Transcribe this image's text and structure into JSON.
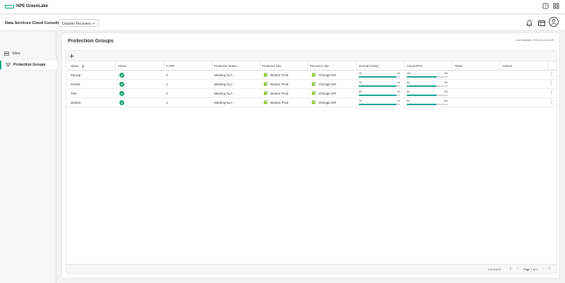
{
  "topbar": {
    "brand": "HPE GreenLake"
  },
  "console": {
    "title": "Data Services Cloud Console",
    "separator": "|",
    "service_selected": "Disaster Recovery"
  },
  "sidebar": {
    "items": [
      {
        "label": "Sites",
        "icon": "server-icon",
        "active": false
      },
      {
        "label": "Protection Groups",
        "icon": "protection-group-icon",
        "active": true
      }
    ]
  },
  "main": {
    "title": "Protection Groups",
    "last_updated": "Last Updated: 2023-04-13 11:25",
    "columns": [
      "Name",
      "Status",
      "# VMs",
      "Protection Status",
      "Protected Site",
      "Recovery Site",
      "Journal History",
      "Actual RPO",
      "Tasks",
      "Actions"
    ],
    "rows": [
      {
        "name": "MyApp",
        "status": "ok",
        "vms": "3",
        "protection_status": "Meeting SLA",
        "protected_site": "Boston Prod",
        "recovery_site": "Chicago DR",
        "journal_min": "7d",
        "journal_max": "1d",
        "journal_fill": 0.92,
        "rpo_min": "10s",
        "rpo_max": "5m",
        "rpo_fill": 0.72
      },
      {
        "name": "Oracle",
        "status": "ok",
        "vms": "1",
        "protection_status": "Meeting SLA",
        "protected_site": "Boston Prod",
        "recovery_site": "Chicago DR",
        "journal_min": "7d",
        "journal_max": "1d",
        "journal_fill": 0.92,
        "rpo_min": "5s",
        "rpo_max": "5m",
        "rpo_fill": 0.72
      },
      {
        "name": "Test",
        "status": "ok",
        "vms": "2",
        "protection_status": "Meeting SLA",
        "protected_site": "Boston Prod",
        "recovery_site": "Chicago DR",
        "journal_min": "6d",
        "journal_max": "1d",
        "journal_fill": 0.92,
        "rpo_min": "5s",
        "rpo_max": "5m",
        "rpo_fill": 0.72
      },
      {
        "name": "Web02",
        "status": "ok",
        "vms": "1",
        "protection_status": "Meeting SLA",
        "protected_site": "Boston Prod",
        "recovery_site": "Chicago DR",
        "journal_min": "7d",
        "journal_max": "1d",
        "journal_fill": 0.92,
        "rpo_min": "5s",
        "rpo_max": "5m",
        "rpo_fill": 0.72
      }
    ],
    "footer": {
      "range": "1 to 4 of 4",
      "page": "Page 1 of 1"
    }
  },
  "colors": {
    "accent": "#01a982",
    "status_ok": "#17a16a",
    "bar_fill": "#17a195",
    "site_icon": "#9acd32"
  }
}
